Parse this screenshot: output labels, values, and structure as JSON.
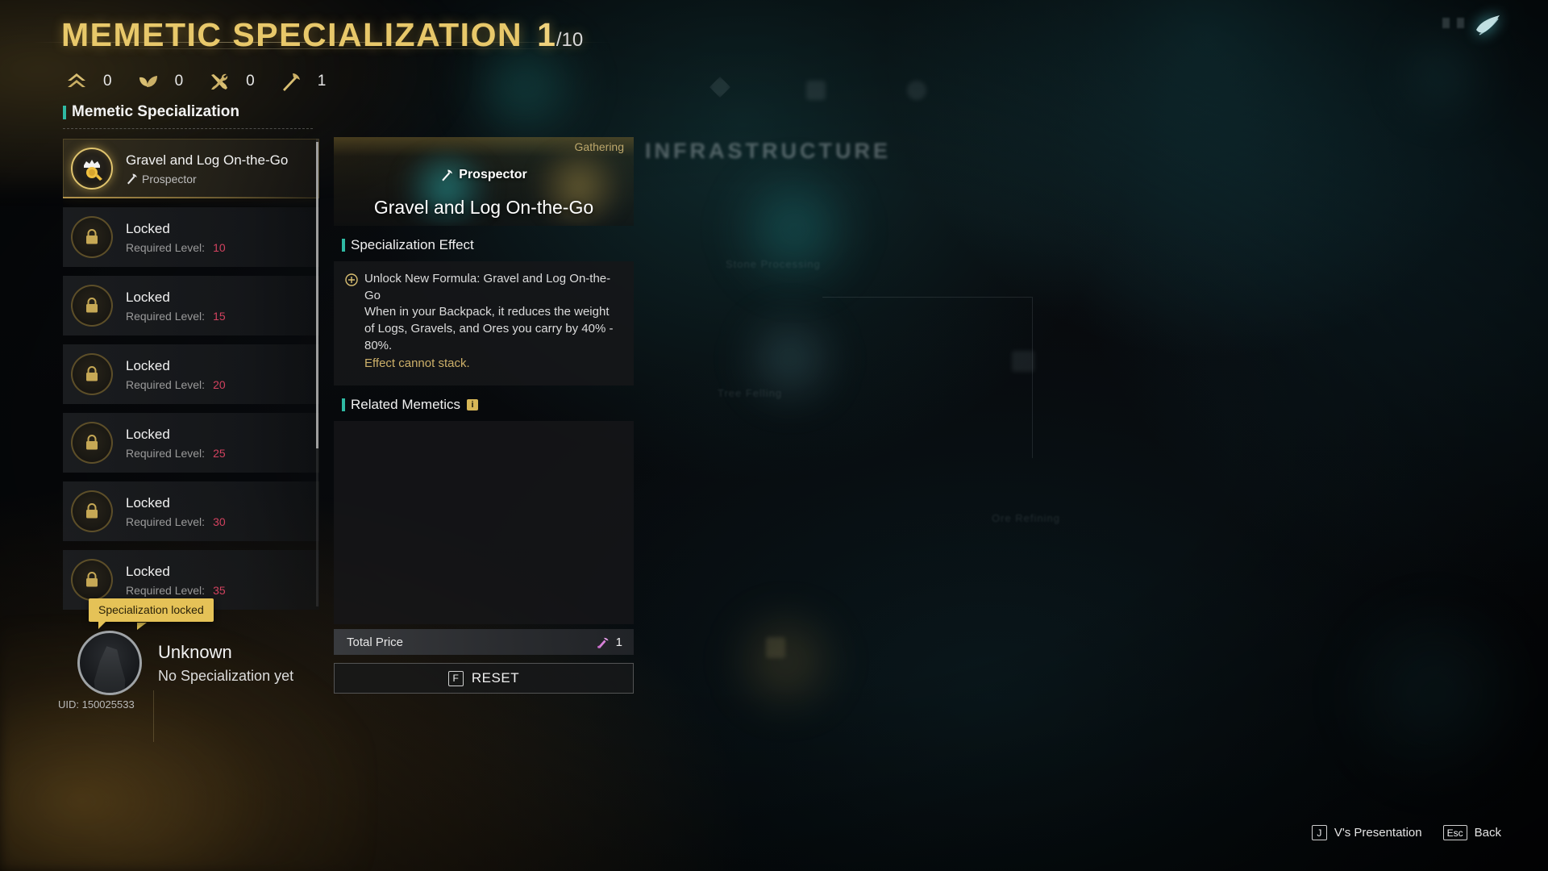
{
  "header": {
    "title": "MEMETIC SPECIALIZATION",
    "current": "1",
    "total": "/10"
  },
  "resources": [
    {
      "icon": "home-chevron-icon",
      "value": "0"
    },
    {
      "icon": "leaf-icon",
      "value": "0"
    },
    {
      "icon": "tools-icon",
      "value": "0"
    },
    {
      "icon": "pickaxe-icon",
      "value": "1"
    }
  ],
  "sidebar": {
    "section_title": "Memetic Specialization",
    "items": [
      {
        "title": "Gravel and Log On-the-Go",
        "role": "Prospector",
        "state": "unlocked"
      },
      {
        "title": "Locked",
        "req_label": "Required Level:",
        "req_level": "10",
        "state": "locked"
      },
      {
        "title": "Locked",
        "req_label": "Required Level:",
        "req_level": "15",
        "state": "locked"
      },
      {
        "title": "Locked",
        "req_label": "Required Level:",
        "req_level": "20",
        "state": "locked"
      },
      {
        "title": "Locked",
        "req_label": "Required Level:",
        "req_level": "25",
        "state": "locked"
      },
      {
        "title": "Locked",
        "req_label": "Required Level:",
        "req_level": "30",
        "state": "locked"
      },
      {
        "title": "Locked",
        "req_label": "Required Level:",
        "req_level": "35",
        "state": "locked"
      }
    ]
  },
  "tooltip": {
    "text": "Specialization locked"
  },
  "player": {
    "name": "Unknown",
    "specialization": "No Specialization yet",
    "uid": "UID: 150025533"
  },
  "detail": {
    "category": "Gathering",
    "role": "Prospector",
    "name": "Gravel and Log On-the-Go",
    "effect_heading": "Specialization Effect",
    "effect_line1": "Unlock New Formula: Gravel and Log On-the-Go",
    "effect_line2": "When in your Backpack, it reduces the weight of Logs, Gravels, and Ores you carry by 40% - 80%.",
    "effect_note": "Effect cannot stack.",
    "related_heading": "Related Memetics",
    "related_info_badge": "i",
    "price_label": "Total Price",
    "price_value": "1",
    "reset_key": "F",
    "reset_label": "RESET"
  },
  "footer": {
    "hints": [
      {
        "key": "J",
        "label": "V's Presentation"
      },
      {
        "key": "Esc",
        "label": "Back"
      }
    ]
  },
  "background": {
    "tree_title": "INFRASTRUCTURE",
    "nodes": [
      {
        "label": "Stone Processing"
      },
      {
        "label": "Tree Felling"
      },
      {
        "label": "Ore Refining"
      }
    ]
  },
  "colors": {
    "gold": "#e8c86a",
    "teal_accent": "#2fb9a3",
    "req_level": "#d2425f",
    "tooltip_bg": "#e5c257",
    "note": "#cdb069"
  }
}
